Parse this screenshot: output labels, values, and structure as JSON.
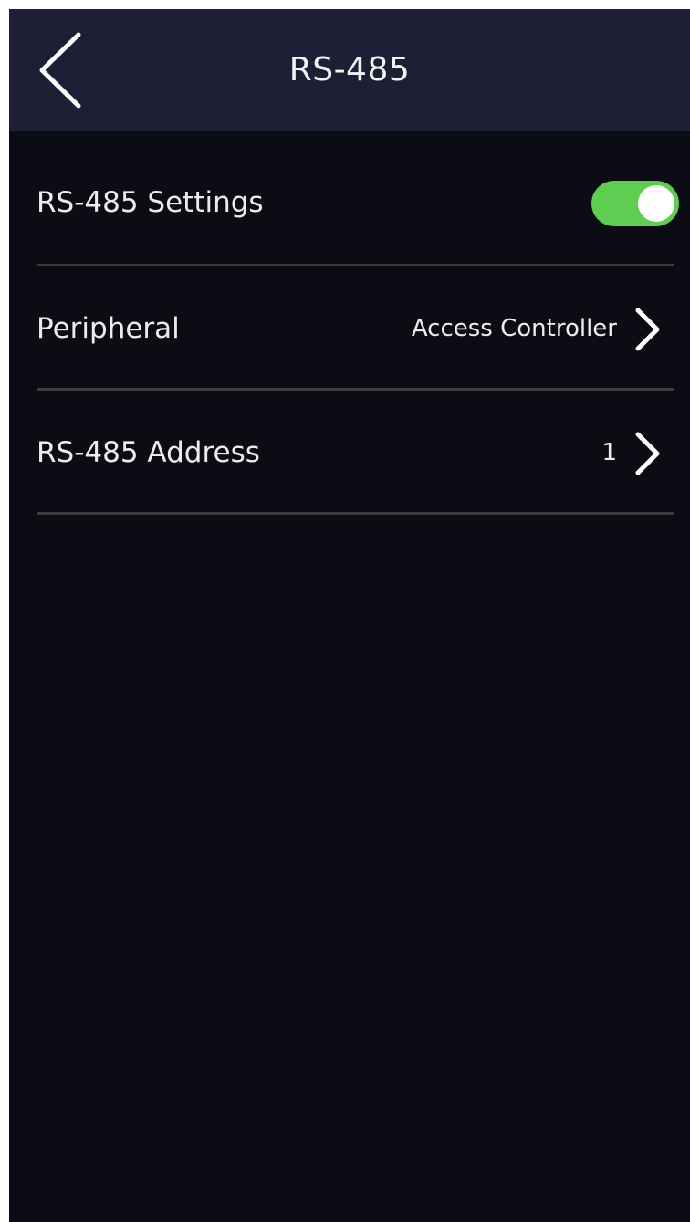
{
  "header": {
    "title": "RS-485",
    "back_icon": "chevron-left-icon"
  },
  "settings": {
    "rs485_settings": {
      "label": "RS-485 Settings",
      "enabled": true,
      "toggle_color": "#5fcc52"
    },
    "peripheral": {
      "label": "Peripheral",
      "value": "Access Controller",
      "icon": "chevron-right-icon"
    },
    "address": {
      "label": "RS-485 Address",
      "value": "1",
      "icon": "chevron-right-icon"
    }
  },
  "colors": {
    "header_bg": "#1d2035",
    "screen_bg": "#0b0c14",
    "divider": "#3a3c40"
  }
}
